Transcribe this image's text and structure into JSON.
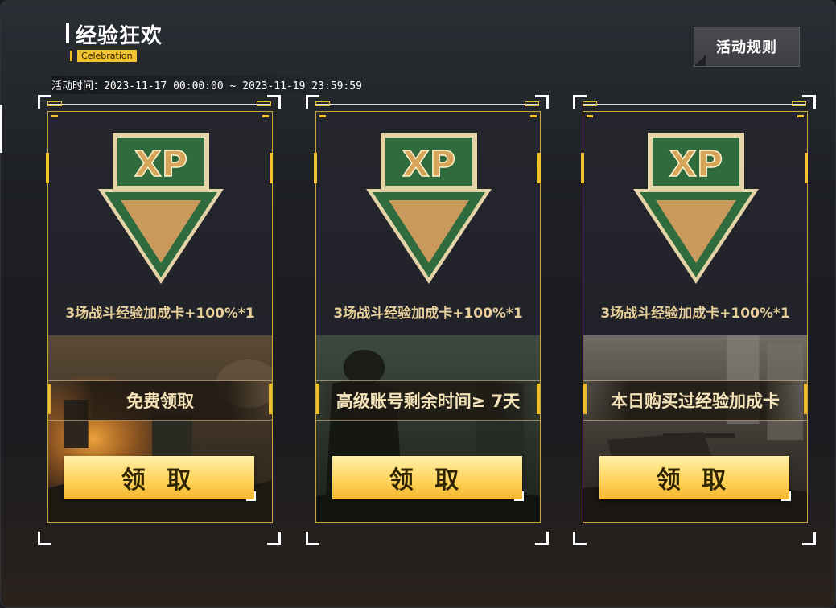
{
  "header": {
    "title": "经验狂欢",
    "subtitle": "Celebration",
    "rules_button": "活动规则",
    "event_time": "活动时间：2023-11-17 00:00:00 ~ 2023-11-19 23:59:59"
  },
  "colors": {
    "accent_gold": "#f2c230",
    "label_gold": "#e6cf98",
    "xp_green": "#2f6b3c"
  },
  "cards": [
    {
      "icon": "xp-badge-icon",
      "reward": "3场战斗经验加成卡+100%*1",
      "condition": "免费领取",
      "claim_label": "领 取"
    },
    {
      "icon": "xp-badge-icon",
      "reward": "3场战斗经验加成卡+100%*1",
      "condition": "高级账号剩余时间≥ 7天",
      "claim_label": "领 取"
    },
    {
      "icon": "xp-badge-icon",
      "reward": "3场战斗经验加成卡+100%*1",
      "condition": "本日购买过经验加成卡",
      "claim_label": "领 取"
    }
  ]
}
